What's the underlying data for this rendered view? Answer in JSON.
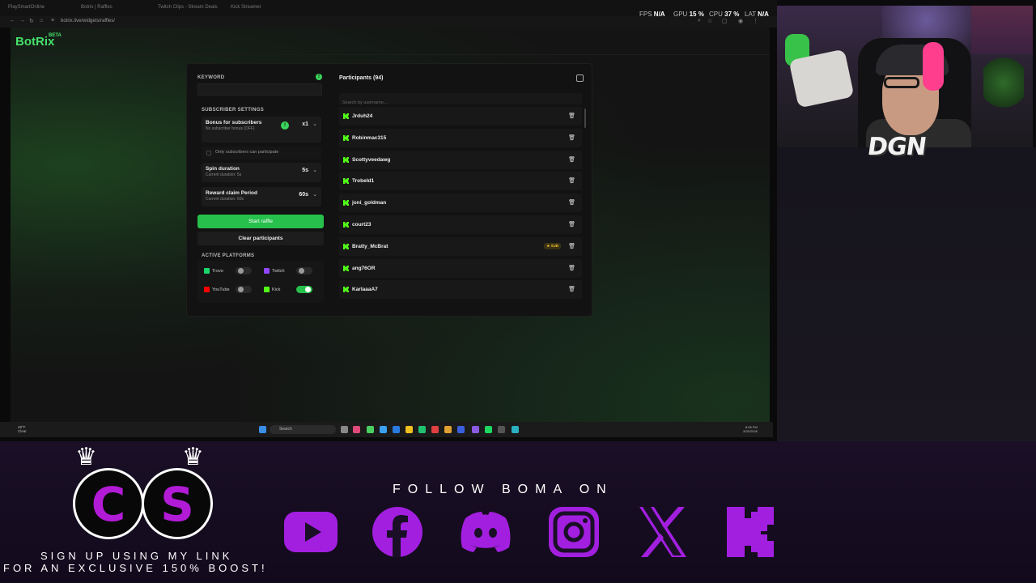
{
  "browser": {
    "tabs": [
      "PlaySmartOnline",
      "Botrix | Raffles",
      "Twitch Clips - Stream Deals",
      "Kick Streamer"
    ],
    "url": "botrix.live/widgets/raffles/",
    "hud": {
      "fps_label": "FPS",
      "fps": "N/A",
      "gpu_label": "GPU",
      "gpu": "15 %",
      "cpu_label": "CPU",
      "cpu": "37 %",
      "lat_label": "LAT",
      "lat": "N/A"
    }
  },
  "app": {
    "logo": "BotRix",
    "logo_badge": "BETA"
  },
  "raffle": {
    "keyword_label": "KEYWORD",
    "subscriber_settings_label": "SUBSCRIBER SETTINGS",
    "bonus": {
      "title": "Bonus for subscribers",
      "subtitle": "No subscriber bonus (OFF)",
      "value": "x1"
    },
    "only_subs_label": "Only subscribers can participate",
    "spin": {
      "title": "Spin duration",
      "subtitle": "Current duration: 5s",
      "value": "5s"
    },
    "reward": {
      "title": "Reward claim Period",
      "subtitle": "Current duration: 60s",
      "value": "60s"
    },
    "start_button": "Start raffle",
    "clear_button": "Clear participants",
    "platforms_label": "ACTIVE PLATFORMS",
    "platforms": [
      {
        "name": "Trovo",
        "enabled": false,
        "color": "#19d66b"
      },
      {
        "name": "Twitch",
        "enabled": false,
        "color": "#9146ff"
      },
      {
        "name": "YouTube",
        "enabled": false,
        "color": "#ff0000"
      },
      {
        "name": "Kick",
        "enabled": true,
        "color": "#53fc18"
      }
    ]
  },
  "participants": {
    "title": "Participants (94)",
    "search_placeholder": "Search by username...",
    "list": [
      {
        "name": "Jrduh24",
        "badge": ""
      },
      {
        "name": "Robinmac315",
        "badge": ""
      },
      {
        "name": "Scottyveedawg",
        "badge": ""
      },
      {
        "name": "Trobeld1",
        "badge": ""
      },
      {
        "name": "joni_goldman",
        "badge": ""
      },
      {
        "name": "court23",
        "badge": ""
      },
      {
        "name": "Bratty_McBrat",
        "badge": "★ SUB"
      },
      {
        "name": "ang76OR",
        "badge": ""
      },
      {
        "name": "KarlaaaA7",
        "badge": ""
      }
    ]
  },
  "taskbar": {
    "weather_temp": "49°F",
    "weather_text": "Clear",
    "search": "Search",
    "time": "8:08 PM",
    "date": "3/25/2026"
  },
  "overlay": {
    "webcam_tag": "DGN",
    "badge_letters": [
      "C",
      "S"
    ],
    "signup_line1": "SIGN UP USING MY LINK",
    "signup_line2": "FOR AN EXCLUSIVE 150% BOOST!",
    "follow_text": "FOLLOW BOMA ON",
    "socials": [
      "youtube-icon",
      "facebook-icon",
      "discord-icon",
      "instagram-icon",
      "x-icon",
      "kick-icon"
    ],
    "accent": "#a21fe0"
  }
}
